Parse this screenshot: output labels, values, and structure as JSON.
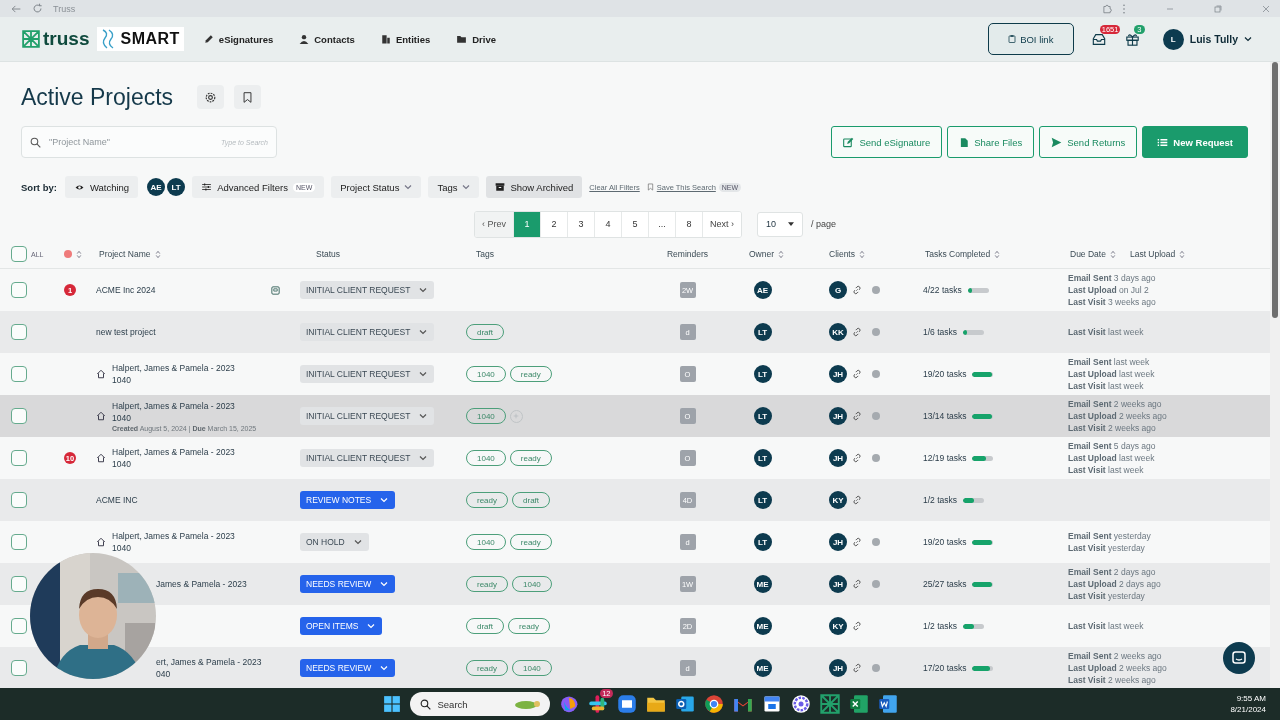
{
  "browser": {
    "title": "Truss"
  },
  "nav": {
    "logo": "truss",
    "brand": "SMART",
    "items": [
      {
        "label": "eSignatures",
        "kind": "pen"
      },
      {
        "label": "Contacts",
        "kind": "person"
      },
      {
        "label": "Entities",
        "kind": "building"
      },
      {
        "label": "Drive",
        "kind": "folder"
      }
    ],
    "boi_button": "BOI link",
    "inbox_badge": "1651",
    "gift_badge": "3",
    "user_initial": "L",
    "user_name": "Luis Tully"
  },
  "page": {
    "title": "Active Projects"
  },
  "search": {
    "placeholder": "\"Project Name\"",
    "hint": "Type to Search"
  },
  "actions": [
    {
      "label": "Send eSignature",
      "kind": "signature",
      "primary": false
    },
    {
      "label": "Share Files",
      "kind": "file",
      "primary": false
    },
    {
      "label": "Send Returns",
      "kind": "send",
      "primary": false
    },
    {
      "label": "New Request",
      "kind": "list",
      "primary": true
    }
  ],
  "filters": {
    "sort_label": "Sort by:",
    "watching": "Watching",
    "owners": [
      "AE",
      "LT"
    ],
    "advanced": "Advanced Filters",
    "advanced_badge": "NEW",
    "project_status": "Project Status",
    "tags": "Tags",
    "archived": "Show Archived",
    "clear": "Clear All Filters",
    "save": "Save This Search",
    "save_badge": "NEW"
  },
  "pagination": {
    "prev": "‹ Prev",
    "next": "Next ›",
    "per_page": "10",
    "per_page_label": "/ page",
    "pages": [
      {
        "label": "1",
        "selected": true
      },
      {
        "label": "2",
        "selected": false
      },
      {
        "label": "3",
        "selected": false
      },
      {
        "label": "4",
        "selected": false
      },
      {
        "label": "5",
        "selected": false
      },
      {
        "label": "...",
        "selected": false
      },
      {
        "label": "8",
        "selected": false
      }
    ]
  },
  "table": {
    "all_label": "ALL",
    "all_checked": false,
    "columns": [
      {
        "label": "Project Name",
        "sortable": true
      },
      {
        "label": "Status",
        "sortable": false
      },
      {
        "label": "Tags",
        "sortable": false
      },
      {
        "label": "Reminders",
        "sortable": false
      },
      {
        "label": "Owner",
        "sortable": true
      },
      {
        "label": "Clients",
        "sortable": true
      },
      {
        "label": "Tasks Completed",
        "sortable": true
      },
      {
        "label": "Due Date",
        "sortable": true
      },
      {
        "label": "Last Upload",
        "sortable": true
      }
    ],
    "rows": [
      {
        "checked": false,
        "highlighted": false,
        "alert": "1",
        "cut": false,
        "name": [
          "ACME Inc 2024"
        ],
        "note_icon": true,
        "status": {
          "label": "INITIAL CLIENT REQUEST",
          "kind": "neutral"
        },
        "tags": [],
        "reminder": "2W",
        "owner": "AE",
        "client": "G",
        "dot": true,
        "tasks": "4/22 tasks",
        "level": 0.18,
        "activity": [
          {
            "label": "Email Sent",
            "value": "3 days ago"
          },
          {
            "label": "Last Upload",
            "value": "on Jul 2"
          },
          {
            "label": "Last Visit",
            "value": "3 weeks ago"
          }
        ]
      },
      {
        "checked": false,
        "highlighted": false,
        "cut": false,
        "name": [
          "new test project"
        ],
        "status": {
          "label": "INITIAL CLIENT REQUEST",
          "kind": "neutral"
        },
        "tags": [
          "draft"
        ],
        "reminder": "d",
        "owner": "LT",
        "client": "KK",
        "dot": true,
        "tasks": "1/6 tasks",
        "level": 0.17,
        "activity": [
          {
            "label": "Last Visit",
            "value": "last week"
          }
        ]
      },
      {
        "checked": false,
        "highlighted": false,
        "home": true,
        "cut": false,
        "name": [
          "Halpert, James & Pamela - 2023",
          "1040"
        ],
        "status": {
          "label": "INITIAL CLIENT REQUEST",
          "kind": "neutral"
        },
        "tags": [
          "1040",
          "ready"
        ],
        "reminder": "O",
        "owner": "LT",
        "client": "JH",
        "dot": true,
        "tasks": "19/20 tasks",
        "level": 0.95,
        "activity": [
          {
            "label": "Email Sent",
            "value": "last week"
          },
          {
            "label": "Last Upload",
            "value": "last week"
          },
          {
            "label": "Last Visit",
            "value": "last week"
          }
        ]
      },
      {
        "checked": false,
        "highlighted": true,
        "home": true,
        "cut": false,
        "name": [
          "Halpert, James & Pamela - 2023",
          "1040"
        ],
        "meta": "**Created** August 5, 2024 | **Due** March 15, 2025",
        "status": {
          "label": "INITIAL CLIENT REQUEST",
          "kind": "neutral"
        },
        "tags": [
          "1040"
        ],
        "add_tag": true,
        "reminder": "O",
        "owner": "LT",
        "client": "JH",
        "dot": true,
        "tasks": "13/14 tasks",
        "level": 0.93,
        "activity": [
          {
            "label": "Email Sent",
            "value": "2 weeks ago"
          },
          {
            "label": "Last Upload",
            "value": "2 weeks ago"
          },
          {
            "label": "Last Visit",
            "value": "2 weeks ago"
          }
        ]
      },
      {
        "checked": false,
        "highlighted": false,
        "alert": "10",
        "home": true,
        "cut": false,
        "name": [
          "Halpert, James & Pamela - 2023",
          "1040"
        ],
        "status": {
          "label": "INITIAL CLIENT REQUEST",
          "kind": "neutral"
        },
        "tags": [
          "1040",
          "ready"
        ],
        "reminder": "O",
        "owner": "LT",
        "client": "JH",
        "dot": true,
        "tasks": "12/19 tasks",
        "level": 0.63,
        "activity": [
          {
            "label": "Email Sent",
            "value": "5 days ago"
          },
          {
            "label": "Last Upload",
            "value": "last week"
          },
          {
            "label": "Last Visit",
            "value": "last week"
          }
        ]
      },
      {
        "checked": false,
        "highlighted": false,
        "cut": false,
        "name": [
          "ACME INC"
        ],
        "status": {
          "label": "REVIEW NOTES",
          "kind": "action"
        },
        "tags": [
          "ready",
          "draft"
        ],
        "reminder": "4D",
        "owner": "LT",
        "client": "KY",
        "tasks": "1/2 tasks",
        "level": 0.5,
        "activity": []
      },
      {
        "checked": false,
        "highlighted": false,
        "home": true,
        "cut": false,
        "name": [
          "Halpert, James & Pamela - 2023",
          "1040"
        ],
        "status": {
          "label": "ON HOLD",
          "kind": "neutral"
        },
        "tags": [
          "1040",
          "ready"
        ],
        "reminder": "d",
        "owner": "LT",
        "client": "JH",
        "dot": true,
        "tasks": "19/20 tasks",
        "level": 0.95,
        "activity": [
          {
            "label": "Email Sent",
            "value": "yesterday"
          },
          {
            "label": "Last Visit",
            "value": "yesterday"
          }
        ]
      },
      {
        "checked": false,
        "highlighted": false,
        "cut": true,
        "name": [
          "James & Pamela - 2023"
        ],
        "status": {
          "label": "NEEDS REVIEW",
          "kind": "action"
        },
        "tags": [
          "ready",
          "1040"
        ],
        "reminder": "1W",
        "owner": "ME",
        "client": "JH",
        "dot": true,
        "tasks": "25/27 tasks",
        "level": 0.93,
        "activity": [
          {
            "label": "Email Sent",
            "value": "2 days ago"
          },
          {
            "label": "Last Upload",
            "value": "2 days ago"
          },
          {
            "label": "Last Visit",
            "value": "yesterday"
          }
        ]
      },
      {
        "checked": false,
        "highlighted": false,
        "name": [],
        "status": {
          "label": "OPEN ITEMS",
          "kind": "action"
        },
        "tags": [
          "draft",
          "ready"
        ],
        "reminder": "2D",
        "owner": "ME",
        "client": "KY",
        "tasks": "1/2 tasks",
        "level": 0.5,
        "activity": [
          {
            "label": "Last Visit",
            "value": "last week"
          }
        ]
      },
      {
        "checked": false,
        "highlighted": false,
        "cut": true,
        "name": [
          "ert, James & Pamela - 2023",
          "040"
        ],
        "status": {
          "label": "NEEDS REVIEW",
          "kind": "action"
        },
        "tags": [
          "ready",
          "1040"
        ],
        "reminder": "d",
        "owner": "ME",
        "client": "JH",
        "dot": true,
        "tasks": "17/20 tasks",
        "level": 0.85,
        "activity": [
          {
            "label": "Email Sent",
            "value": "2 weeks ago"
          },
          {
            "label": "Last Upload",
            "value": "2 weeks ago"
          },
          {
            "label": "Last Visit",
            "value": "2 weeks ago"
          }
        ]
      }
    ]
  },
  "taskbar": {
    "search": "Search",
    "time": "9:55 AM",
    "date": "8/21/2024",
    "apps": [
      {
        "kind": "colorful"
      },
      {
        "kind": "hash",
        "badge": "12"
      },
      {
        "kind": "blue"
      },
      {
        "kind": "folder"
      },
      {
        "kind": "outlook"
      },
      {
        "kind": "chrome"
      },
      {
        "kind": "gmail"
      },
      {
        "kind": "calendar"
      },
      {
        "kind": "flower"
      },
      {
        "kind": "truss"
      },
      {
        "kind": "excel"
      },
      {
        "kind": "word"
      }
    ]
  }
}
